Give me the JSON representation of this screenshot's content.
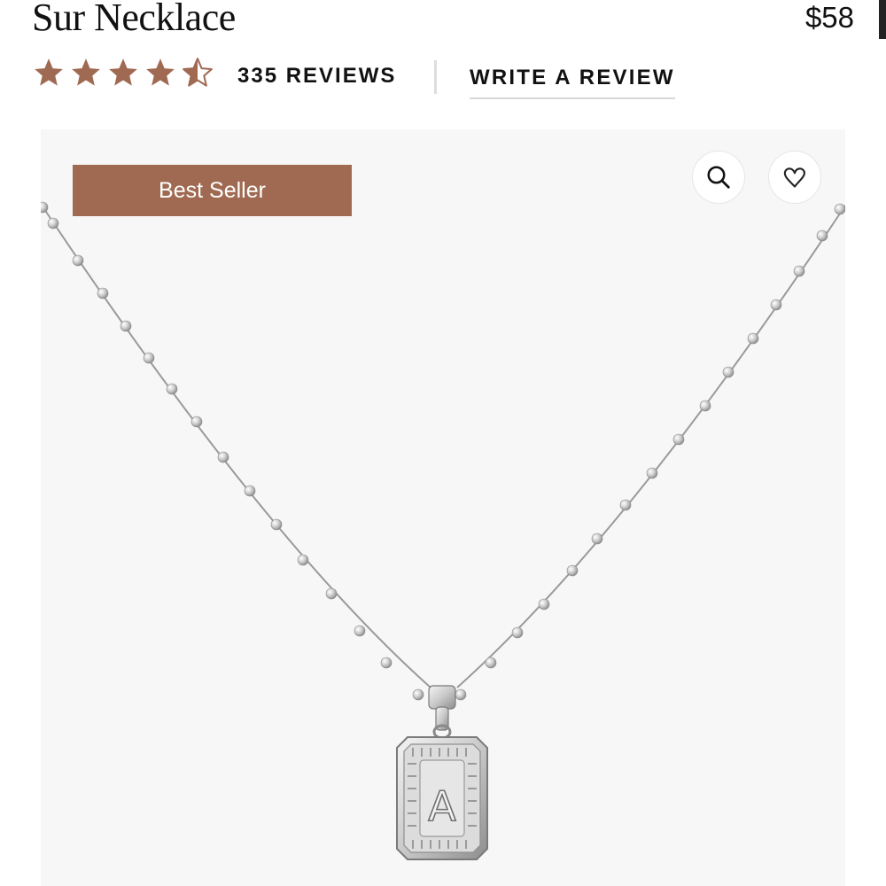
{
  "product": {
    "title": "Sur Necklace",
    "price": "$58"
  },
  "reviews": {
    "rating": 4.5,
    "count_label": "335 REVIEWS",
    "write_label": "WRITE A REVIEW"
  },
  "gallery": {
    "badge": "Best Seller",
    "pendant_letter": "A"
  },
  "icons": {
    "zoom": "search-icon",
    "favorite": "heart-icon"
  },
  "colors": {
    "accent": "#a06a52",
    "star": "#a06a52",
    "gallery_bg": "#f7f7f7"
  }
}
